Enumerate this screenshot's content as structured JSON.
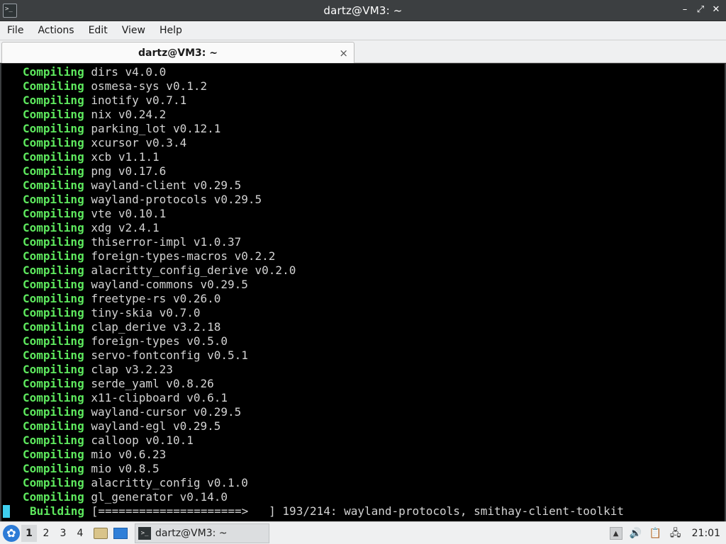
{
  "window": {
    "title": "dartz@VM3: ~",
    "app_icon": "terminal-icon",
    "controls": [
      "minimize",
      "maximize",
      "close"
    ]
  },
  "menu": {
    "items": [
      "File",
      "Actions",
      "Edit",
      "View",
      "Help"
    ]
  },
  "tab": {
    "label": "dartz@VM3: ~",
    "close_glyph": "×"
  },
  "terminal": {
    "lines": [
      {
        "verb": "Compiling",
        "text": "dirs v4.0.0"
      },
      {
        "verb": "Compiling",
        "text": "osmesa-sys v0.1.2"
      },
      {
        "verb": "Compiling",
        "text": "inotify v0.7.1"
      },
      {
        "verb": "Compiling",
        "text": "nix v0.24.2"
      },
      {
        "verb": "Compiling",
        "text": "parking_lot v0.12.1"
      },
      {
        "verb": "Compiling",
        "text": "xcursor v0.3.4"
      },
      {
        "verb": "Compiling",
        "text": "xcb v1.1.1"
      },
      {
        "verb": "Compiling",
        "text": "png v0.17.6"
      },
      {
        "verb": "Compiling",
        "text": "wayland-client v0.29.5"
      },
      {
        "verb": "Compiling",
        "text": "wayland-protocols v0.29.5"
      },
      {
        "verb": "Compiling",
        "text": "vte v0.10.1"
      },
      {
        "verb": "Compiling",
        "text": "xdg v2.4.1"
      },
      {
        "verb": "Compiling",
        "text": "thiserror-impl v1.0.37"
      },
      {
        "verb": "Compiling",
        "text": "foreign-types-macros v0.2.2"
      },
      {
        "verb": "Compiling",
        "text": "alacritty_config_derive v0.2.0"
      },
      {
        "verb": "Compiling",
        "text": "wayland-commons v0.29.5"
      },
      {
        "verb": "Compiling",
        "text": "freetype-rs v0.26.0"
      },
      {
        "verb": "Compiling",
        "text": "tiny-skia v0.7.0"
      },
      {
        "verb": "Compiling",
        "text": "clap_derive v3.2.18"
      },
      {
        "verb": "Compiling",
        "text": "foreign-types v0.5.0"
      },
      {
        "verb": "Compiling",
        "text": "servo-fontconfig v0.5.1"
      },
      {
        "verb": "Compiling",
        "text": "clap v3.2.23"
      },
      {
        "verb": "Compiling",
        "text": "serde_yaml v0.8.26"
      },
      {
        "verb": "Compiling",
        "text": "x11-clipboard v0.6.1"
      },
      {
        "verb": "Compiling",
        "text": "wayland-cursor v0.29.5"
      },
      {
        "verb": "Compiling",
        "text": "wayland-egl v0.29.5"
      },
      {
        "verb": "Compiling",
        "text": "calloop v0.10.1"
      },
      {
        "verb": "Compiling",
        "text": "mio v0.6.23"
      },
      {
        "verb": "Compiling",
        "text": "mio v0.8.5"
      },
      {
        "verb": "Compiling",
        "text": "alacritty_config v0.1.0"
      },
      {
        "verb": "Compiling",
        "text": "gl_generator v0.14.0"
      }
    ],
    "status": {
      "verb": "Building",
      "text": "[=====================>   ] 193/214: wayland-protocols, smithay-client-toolkit"
    },
    "colors": {
      "verb": "#5ee95e",
      "text": "#d3d3d3",
      "background": "#000000",
      "cursor": "#3fd0f0"
    }
  },
  "taskbar": {
    "start_icon": "lxqt-start-icon",
    "desktops": [
      "1",
      "2",
      "3",
      "4"
    ],
    "active_desktop": "1",
    "task_label": "dartz@VM3: ~",
    "tray_icons": [
      "scroll-up-icon",
      "volume-icon",
      "clipboard-icon",
      "network-icon"
    ],
    "clock": "21:01"
  }
}
